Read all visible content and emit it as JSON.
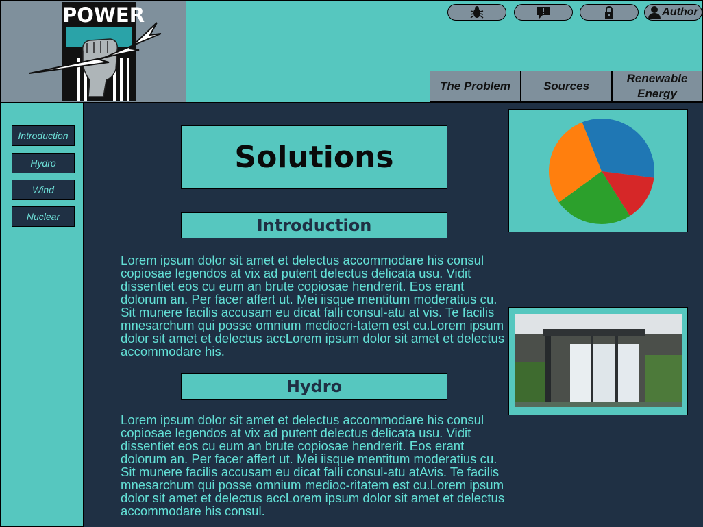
{
  "header": {
    "logo_text": "POWER",
    "toolbar": {
      "bug_icon": "bug-icon",
      "feedback_icon": "feedback-icon",
      "lock_icon": "lock-icon",
      "author_label": "Author"
    },
    "nav": {
      "problem": "The Problem",
      "sources": "Sources",
      "renewable": "Renewable Energy"
    }
  },
  "sidebar": {
    "items": [
      {
        "label": "Introduction"
      },
      {
        "label": "Hydro"
      },
      {
        "label": "Wind"
      },
      {
        "label": "Nuclear"
      }
    ]
  },
  "main": {
    "title": "Solutions",
    "sections": [
      {
        "heading": "Introduction",
        "body": "Lorem ipsum dolor sit amet et delectus accommodare his consul copiosae legendos at vix ad putent delectus delicata usu. Vidit dissentiet eos cu eum an brute copiosae hendrerit. Eos erant dolorum an. Per facer affert ut. Mei iisque mentitum moderatius cu. Sit munere facilis accusam eu dicat falli consul-atu at vis. Te facilis mnesarchum qui posse omnium mediocri-tatem est cu.Lorem ipsum dolor sit amet et delectus accLorem ipsum dolor sit amet et delectus accommodare his."
      },
      {
        "heading": "Hydro",
        "body": "Lorem ipsum dolor sit amet et delectus accommodare his consul copiosae legendos at vix ad putent delectus delicata usu. Vidit dissentiet eos cu eum an brute copiosae hendrerit. Eos erant dolorum an. Per facer affert ut. Mei iisque mentitum moderatius cu. Sit munere facilis accusam eu dicat falli consul-atu atAvis. Te facilis mnesarchum qui posse omnium medioc-ritatem est cu.Lorem ipsum dolor sit amet et delectus accLorem ipsum dolor sit amet et delectus accommodare his consul."
      }
    ]
  },
  "aside": {
    "pie": {
      "slices": [
        {
          "fraction": 0.33,
          "color": "#1f77b4"
        },
        {
          "fraction": 0.14,
          "color": "#d62728"
        },
        {
          "fraction": 0.24,
          "color": "#2ca02c"
        },
        {
          "fraction": 0.29,
          "color": "#ff7f0e"
        }
      ]
    },
    "photo": {
      "subject": "dam-spillway-photo"
    }
  },
  "colors": {
    "teal": "#56c7bf",
    "navy": "#1f3044",
    "gray": "#7f909c",
    "text": "#63e0d6"
  }
}
